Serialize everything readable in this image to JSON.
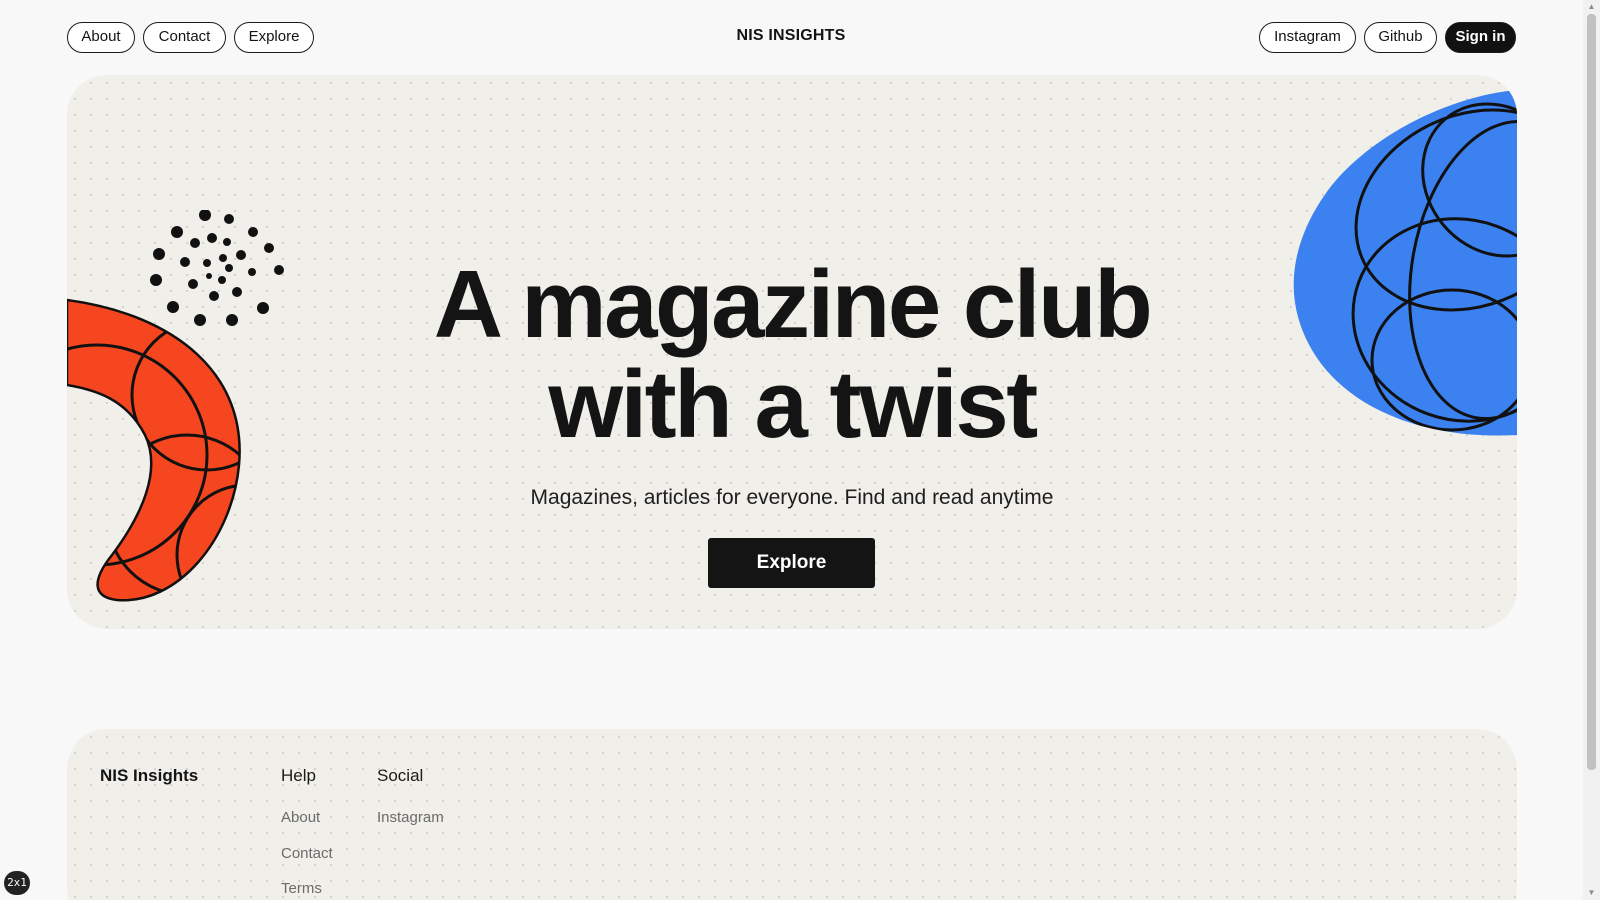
{
  "header": {
    "nav_left": [
      {
        "label": "About"
      },
      {
        "label": "Contact"
      },
      {
        "label": "Explore"
      }
    ],
    "brand": "NIS INSIGHTS",
    "nav_right": [
      {
        "label": "Instagram"
      },
      {
        "label": "Github"
      }
    ],
    "sign_in_label": "Sign in"
  },
  "hero": {
    "headline_line1": "A magazine club",
    "headline_line2": "with a twist",
    "tagline": "Magazines, articles for everyone. Find and read anytime",
    "cta_label": "Explore",
    "colors": {
      "background": "#f1efe9",
      "orange_shape": "#f6461f",
      "blue_shape": "#3b82f0",
      "ink": "#141414"
    }
  },
  "footer": {
    "brand": "NIS Insights",
    "columns": [
      {
        "title": "Help",
        "links": [
          "About",
          "Contact",
          "Terms"
        ]
      },
      {
        "title": "Social",
        "links": [
          "Instagram"
        ]
      }
    ]
  },
  "zoom_badge": "2x1",
  "icons": [
    "dot-spiral-icon",
    "orange-crescent-shape",
    "blue-blob-shape",
    "scroll-up-arrow-icon",
    "scroll-down-arrow-icon"
  ]
}
